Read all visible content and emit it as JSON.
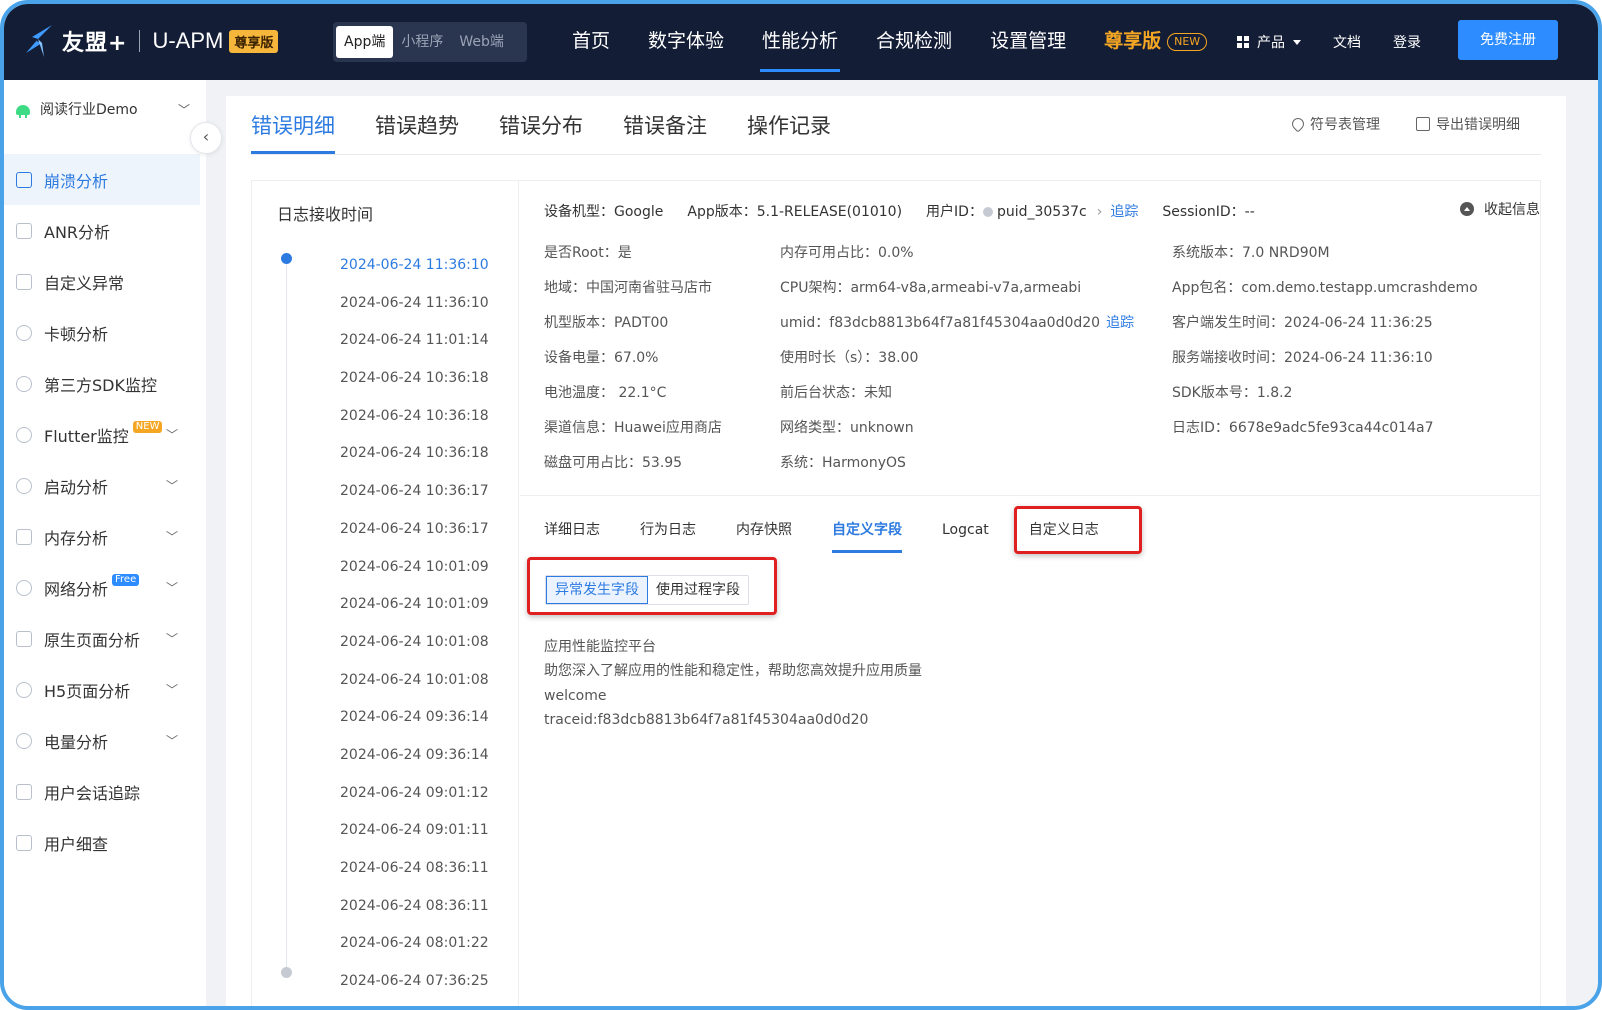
{
  "brand": {
    "name": "友盟+",
    "product": "U-APM",
    "edition_badge": "尊享版"
  },
  "platform_switch": [
    "App端",
    "小程序",
    "Web端"
  ],
  "top_nav": [
    {
      "label": "首页"
    },
    {
      "label": "数字体验"
    },
    {
      "label": "性能分析",
      "active": true
    },
    {
      "label": "合规检测"
    },
    {
      "label": "设置管理"
    },
    {
      "label": "尊享版",
      "badge": "NEW"
    }
  ],
  "right_nav": {
    "products": "产品",
    "docs": "文档",
    "login": "登录",
    "register": "免费注册"
  },
  "sidebar": {
    "app_name": "阅读行业Demo",
    "items": [
      {
        "label": "崩溃分析",
        "active": true
      },
      {
        "label": "ANR分析"
      },
      {
        "label": "自定义异常"
      },
      {
        "label": "卡顿分析"
      },
      {
        "label": "第三方SDK监控"
      },
      {
        "label": "Flutter监控",
        "tag": "NEW",
        "expandable": true
      },
      {
        "label": "启动分析",
        "expandable": true
      },
      {
        "label": "内存分析",
        "expandable": true
      },
      {
        "label": "网络分析",
        "tag": "Free",
        "expandable": true
      },
      {
        "label": "原生页面分析",
        "expandable": true
      },
      {
        "label": "H5页面分析",
        "expandable": true
      },
      {
        "label": "电量分析",
        "expandable": true
      },
      {
        "label": "用户会话追踪"
      },
      {
        "label": "用户细查"
      }
    ]
  },
  "tabs": [
    "错误明细",
    "错误趋势",
    "错误分布",
    "错误备注",
    "操作记录"
  ],
  "tools": {
    "symbol": "符号表管理",
    "export": "导出错误明细"
  },
  "timeline": {
    "title": "日志接收时间",
    "items": [
      "2024-06-24 11:36:10",
      "2024-06-24 11:36:10",
      "2024-06-24 11:01:14",
      "2024-06-24 10:36:18",
      "2024-06-24 10:36:18",
      "2024-06-24 10:36:18",
      "2024-06-24 10:36:17",
      "2024-06-24 10:36:17",
      "2024-06-24 10:01:09",
      "2024-06-24 10:01:09",
      "2024-06-24 10:01:08",
      "2024-06-24 10:01:08",
      "2024-06-24 09:36:14",
      "2024-06-24 09:36:14",
      "2024-06-24 09:01:12",
      "2024-06-24 09:01:11",
      "2024-06-24 08:36:11",
      "2024-06-24 08:36:11",
      "2024-06-24 08:01:22",
      "2024-06-24 07:36:25"
    ]
  },
  "info_head": {
    "device_model": "设备机型：Google",
    "app_version": "App版本：5.1-RELEASE(01010)",
    "user_id_label": "用户ID：",
    "user_id": "puid_30537c",
    "trace": "追踪",
    "session": "SessionID：--",
    "collapse": "收起信息"
  },
  "info": {
    "col1": [
      "是否Root：是",
      "地域：中国河南省驻马店市",
      "机型版本：PADT00",
      "设备电量：67.0%",
      "电池温度： 22.1°C",
      "渠道信息：Huawei应用商店",
      "磁盘可用占比：53.95"
    ],
    "col2": [
      "内存可用占比：0.0%",
      "CPU架构：arm64-v8a,armeabi-v7a,armeabi",
      "umid：f83dcb8813b64f7a81f45304aa0d0d20",
      "使用时长（s）：38.00",
      "前后台状态：未知",
      "网络类型：unknown",
      "系统：HarmonyOS"
    ],
    "col3": [
      "系统版本：7.0 NRD90M",
      "App包名：com.demo.testapp.umcrashdemo",
      "客户端发生时间：2024-06-24 11:36:25",
      "服务端接收时间：2024-06-24 11:36:10",
      "SDK版本号：1.8.2",
      "日志ID：6678e9adc5fe93ca44c014a7"
    ],
    "umid_trace": "追踪"
  },
  "sub_tabs": [
    "详细日志",
    "行为日志",
    "内存快照",
    "自定义字段",
    "Logcat",
    "自定义日志"
  ],
  "segments": [
    "异常发生字段",
    "使用过程字段"
  ],
  "log_lines": [
    "应用性能监控平台",
    "助您深入了解应用的性能和稳定性，帮助您高效提升应用质量",
    "welcome",
    "traceid:f83dcb8813b64f7a81f45304aa0d0d20"
  ]
}
